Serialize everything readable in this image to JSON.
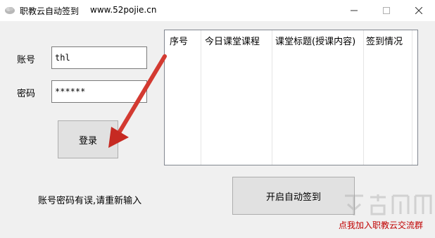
{
  "window": {
    "title": "职教云自动签到",
    "url_text": "www.52pojie.cn"
  },
  "login": {
    "account_label": "账号",
    "account_value": "thl",
    "password_label": "密码",
    "password_value": "******",
    "login_button": "登录"
  },
  "grid": {
    "columns": [
      "序号",
      "今日课堂课程",
      "课堂标题(授课内容)",
      "签到情况"
    ]
  },
  "status_text": "账号密码有误,请重新输入",
  "auto_sign_button": "开启自动签到",
  "join_group_link": "点我加入职教云交流群",
  "colors": {
    "accent_arrow": "#d9302a",
    "link": "#c00000"
  }
}
